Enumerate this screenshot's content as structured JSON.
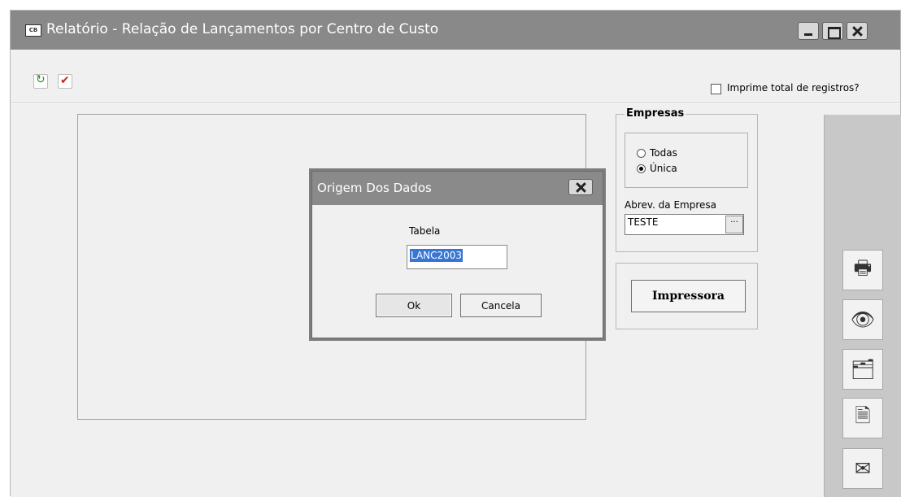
{
  "window": {
    "title": "Relatório - Relação de Lançamentos por Centro de Custo",
    "icon_label": "CB"
  },
  "toolbar": {
    "total_label": "Imprime total de registros?",
    "total_checked": false
  },
  "empresas": {
    "title": "Empresas",
    "options": [
      {
        "label": "Todas",
        "selected": false
      },
      {
        "label": "Única",
        "selected": true
      }
    ],
    "abrev_label": "Abrev. da Empresa",
    "abrev_value": "TESTE",
    "browse_label": "···"
  },
  "printer": {
    "button_label": "Impressora"
  },
  "side_actions": {
    "print_icon": "🖶",
    "preview_icon": "👁",
    "export_icon": "🗂",
    "delete_icon": "🗎",
    "mail_icon": "✉"
  },
  "dialog": {
    "title": "Origem Dos Dados",
    "field_label": "Tabela",
    "field_value": "LANC2003",
    "ok_label": "Ok",
    "cancel_label": "Cancela"
  }
}
